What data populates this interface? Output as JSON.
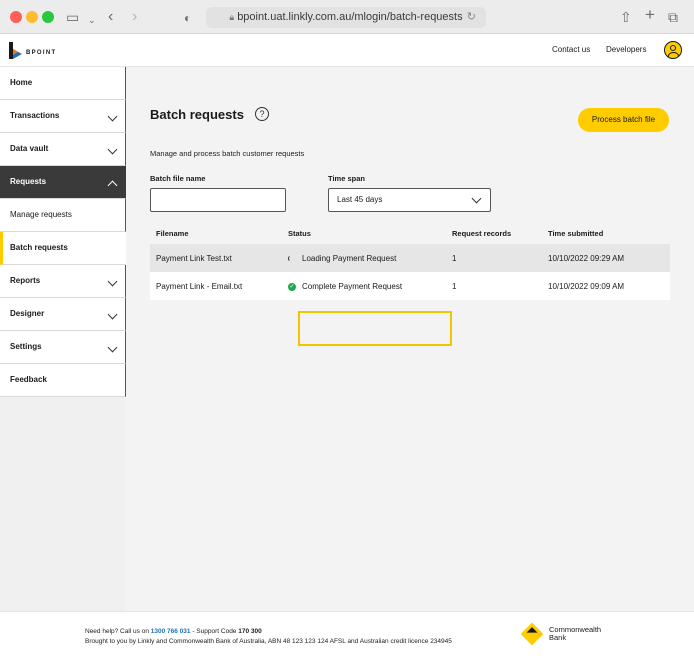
{
  "browser": {
    "url_text": "bpoint.uat.linkly.com.au/mlogin/batch-requests"
  },
  "header": {
    "logo_text": "BPOINT",
    "contact_label": "Contact us",
    "developers_label": "Developers",
    "colors": {
      "accent": "#ffcc00",
      "logo_blue": "#1e6fb8",
      "logo_dark": "#1a1a1a"
    }
  },
  "sidebar": {
    "items": [
      {
        "label": "Home"
      },
      {
        "label": "Transactions"
      },
      {
        "label": "Data vault"
      },
      {
        "label": "Requests"
      },
      {
        "label": "Manage requests"
      },
      {
        "label": "Batch requests"
      },
      {
        "label": "Reports"
      },
      {
        "label": "Designer"
      },
      {
        "label": "Settings"
      },
      {
        "label": "Feedback"
      }
    ]
  },
  "main": {
    "title": "Batch requests",
    "help_glyph": "?",
    "process_button": "Process batch file",
    "subtitle": "Manage and process batch customer requests",
    "filename_label": "Batch file name",
    "filename_value": "",
    "timespan_label": "Time span",
    "timespan_value": "Last 45 days",
    "table": {
      "headers": [
        "Filename",
        "Status",
        "Request records",
        "Time submitted"
      ],
      "rows": [
        {
          "filename": "Payment Link Test.txt",
          "status": "Loading Payment Request",
          "records": "1",
          "time": "10/10/2022 09:29 AM"
        },
        {
          "filename": "Payment Link - Email.txt",
          "status": "Complete Payment Request",
          "records": "1",
          "time": "10/10/2022 09:09 AM"
        }
      ]
    }
  },
  "footer": {
    "help_prefix": "Need help? Call us on ",
    "phone": "1300 766 031",
    "support_prefix": " - Support Code ",
    "support_code": "170 300",
    "line2": "Brought to you by Linkly and Commonwealth Bank of Australia, ABN 48 123 123 124 AFSL and Australian credit licence 234945",
    "bank_name_1": "Commonwealth",
    "bank_name_2": "Bank"
  }
}
